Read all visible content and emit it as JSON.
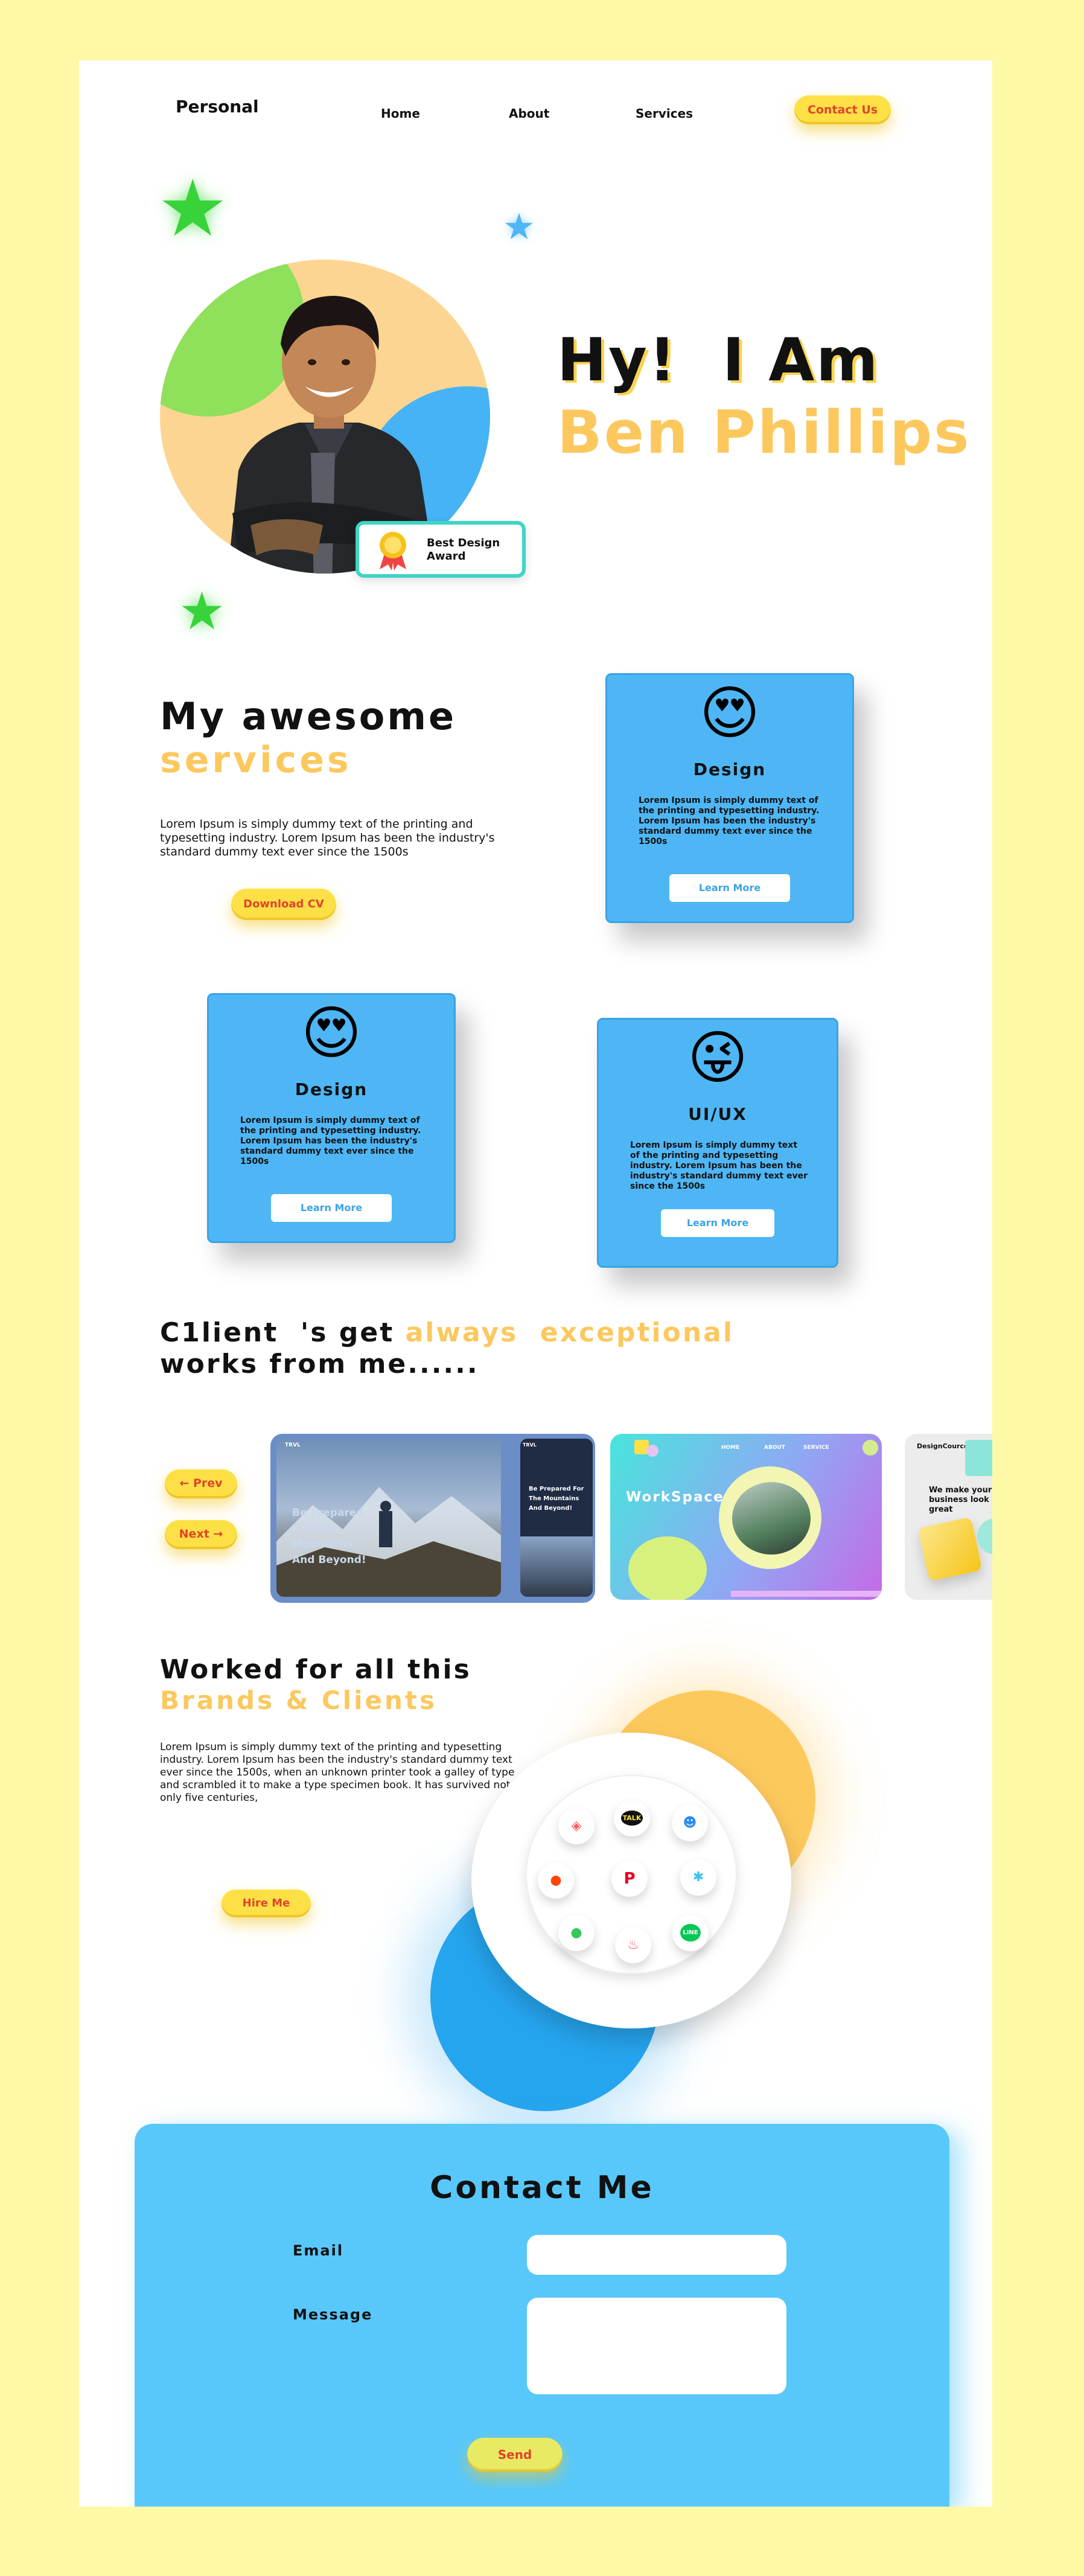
{
  "nav": {
    "brand": "Personal",
    "links": [
      "Home",
      "About",
      "Services"
    ],
    "contact": "Contact Us"
  },
  "hero": {
    "line1": "Hy!  I Am",
    "line2": "Ben Phillips",
    "award": "Best Design\nAward"
  },
  "services": {
    "title": "My awesome",
    "title2": "services",
    "text": "Lorem Ipsum is simply dummy text of the printing and\ntypesetting industry. Lorem Ipsum has been the industry's\nstandard dummy text ever since the 1500s",
    "download": "Download CV",
    "cards": [
      {
        "emoji": "😍",
        "title": "Design",
        "text": "Lorem Ipsum is simply dummy text of the printing and typesetting industry. Lorem Ipsum has been the industry's standard dummy text ever since the 1500s",
        "button": "Learn More"
      },
      {
        "emoji": "😍",
        "title": "Design",
        "text": "Lorem Ipsum is simply dummy text of the printing and typesetting industry. Lorem Ipsum has been the industry's standard dummy text ever since the 1500s",
        "button": "Learn More"
      },
      {
        "emoji": "😜",
        "title": "UI/UX",
        "text": "Lorem Ipsum is simply dummy text of the printing and typesetting industry. Lorem Ipsum has been the industry's standard dummy text ever since the 1500s",
        "button": "Learn More"
      }
    ]
  },
  "clients": {
    "title_a": "C1lient  's get ",
    "title_b": "always  exceptional",
    "title_c": "works from me......",
    "prev": "Prev",
    "next": "Next",
    "shot1": {
      "headline": "Be Prepared\nFor The\nMountains\nAnd Beyond!",
      "side": "Be Prepared For\nThe Mountains\nAnd Beyond!",
      "logo": "TRVL"
    },
    "shot2": {
      "brand": "WorkSpaceCO.",
      "nav": [
        "HOME",
        "ABOUT",
        "SERVICE"
      ]
    },
    "shot3": {
      "brand": "DesignCource",
      "tagline": "We make your\nbusiness look\ngreat"
    }
  },
  "brands": {
    "title": "Worked for all this",
    "subtitle": "Brands & Clients",
    "text": "Lorem Ipsum is simply dummy text of the printing and typesetting industry. Lorem Ipsum has been the industry's standard dummy text ever since the 1500s, when an unknown printer took a galley of type and scrambled it to make a type specimen book. It has survived not only five centuries,",
    "hire": "Hire Me",
    "logos": [
      {
        "icon": "airbnb-icon",
        "glyph": "◈",
        "color": "#ff5a5f"
      },
      {
        "icon": "kakaotalk-icon",
        "glyph": "TALK",
        "color": "#111111"
      },
      {
        "icon": "finder-icon",
        "glyph": "☻",
        "color": "#2d8cf0"
      },
      {
        "icon": "reddit-icon",
        "glyph": "●",
        "color": "#ff4500"
      },
      {
        "icon": "pinterest-icon",
        "glyph": "P",
        "color": "#e60023"
      },
      {
        "icon": "slack-icon",
        "glyph": "✱",
        "color": "#36c5f0"
      },
      {
        "icon": "messages-icon",
        "glyph": "●",
        "color": "#34c759"
      },
      {
        "icon": "tinder-icon",
        "glyph": "♨",
        "color": "#fd5068"
      },
      {
        "icon": "line-icon",
        "glyph": "LINE",
        "color": "#06c755"
      }
    ]
  },
  "contact": {
    "title": "Contact Me",
    "email_label": "Email",
    "message_label": "Message",
    "send": "Send"
  }
}
